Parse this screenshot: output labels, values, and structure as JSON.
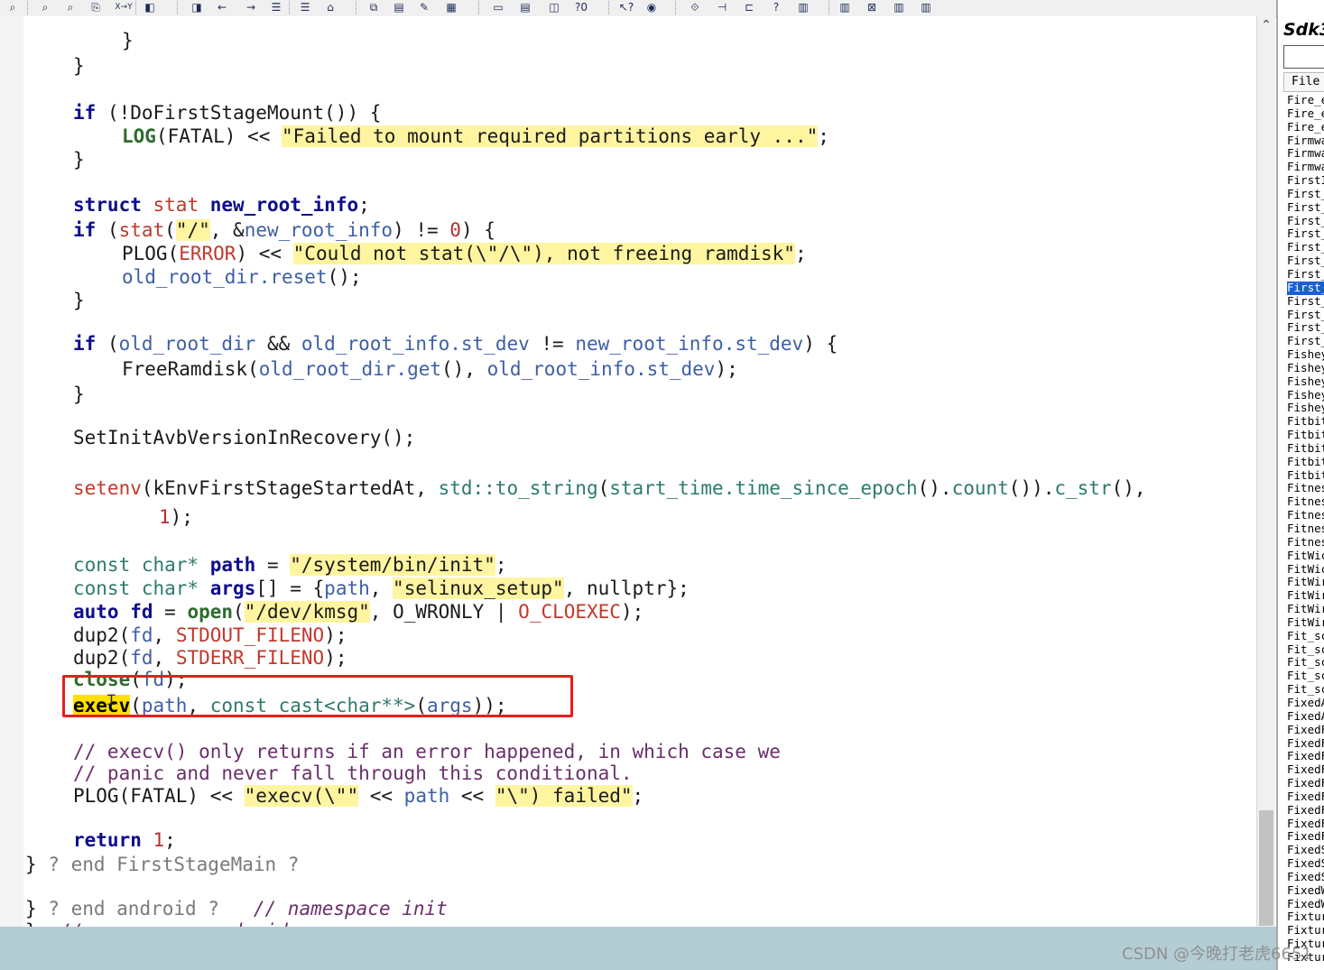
{
  "toolbar": {
    "buttons": [
      {
        "label": "⌕",
        "name": "find-icon"
      },
      {
        "label": "⌕",
        "name": "find-previous-icon"
      },
      {
        "label": "⌕",
        "name": "find-next-icon"
      },
      {
        "label": "⎘",
        "name": "find-in-files-icon"
      },
      {
        "label": "X→Y",
        "name": "replace-icon"
      },
      {
        "label": "◧",
        "name": "bookmark-icon"
      },
      {
        "label": "◨",
        "name": "bookmark-next-icon"
      },
      {
        "label": "←",
        "name": "back-arrow-icon"
      },
      {
        "label": "→",
        "name": "forward-arrow-icon"
      },
      {
        "label": "☰",
        "name": "indent-icon"
      },
      {
        "label": "☰",
        "name": "outdent-icon"
      },
      {
        "label": "⌂",
        "name": "lookup-icon"
      },
      {
        "label": "⧉",
        "name": "jump-icon"
      },
      {
        "label": "▤",
        "name": "book-icon"
      },
      {
        "label": "✎",
        "name": "edit-icon"
      },
      {
        "label": "▦",
        "name": "grid-icon"
      },
      {
        "label": "▭",
        "name": "window-icon"
      },
      {
        "label": "▤",
        "name": "tile-icon"
      },
      {
        "label": "◫",
        "name": "cascade-icon"
      },
      {
        "label": "?0",
        "name": "query-icon"
      },
      {
        "label": "↖?",
        "name": "context-help-icon"
      },
      {
        "label": "◉",
        "name": "browse-icon"
      },
      {
        "label": "⟐",
        "name": "symbol-icon"
      },
      {
        "label": "⊣",
        "name": "relation-icon"
      },
      {
        "label": "⊏",
        "name": "structure-icon"
      },
      {
        "label": "?",
        "name": "help-icon"
      },
      {
        "label": "▥",
        "name": "project-icon"
      },
      {
        "label": "▥",
        "name": "project-open-icon"
      },
      {
        "label": "⊠",
        "name": "project-close-icon"
      },
      {
        "label": "▥",
        "name": "project-add-icon"
      },
      {
        "label": "▥",
        "name": "project-sync-icon"
      }
    ]
  },
  "editor": {
    "lines": [
      {
        "t": 14,
        "l": 109,
        "segs": [
          {
            "c": "p",
            "t": "}"
          }
        ]
      },
      {
        "t": 42,
        "l": 55,
        "segs": [
          {
            "c": "p",
            "t": "}"
          }
        ]
      },
      {
        "t": 94,
        "l": 55,
        "segs": [
          {
            "c": "kw",
            "t": "if"
          },
          {
            "c": "p",
            "t": " (!DoFirstStageMount()) {"
          }
        ]
      },
      {
        "t": 120,
        "l": 109,
        "segs": [
          {
            "c": "fn2",
            "t": "LOG"
          },
          {
            "c": "p",
            "t": "(FATAL) << "
          },
          {
            "c": "str",
            "t": "\"Failed to mount required partitions early ...\""
          },
          {
            "c": "p",
            "t": ";"
          }
        ]
      },
      {
        "t": 146,
        "l": 55,
        "segs": [
          {
            "c": "p",
            "t": "}"
          }
        ]
      },
      {
        "t": 196,
        "l": 55,
        "segs": [
          {
            "c": "kw",
            "t": "struct"
          },
          {
            "c": "p",
            "t": " "
          },
          {
            "c": "mac",
            "t": "stat"
          },
          {
            "c": "p",
            "t": " "
          },
          {
            "c": "kw",
            "t": "new_root_info"
          },
          {
            "c": "p",
            "t": ";"
          }
        ]
      },
      {
        "t": 224,
        "l": 55,
        "segs": [
          {
            "c": "kw",
            "t": "if"
          },
          {
            "c": "p",
            "t": " ("
          },
          {
            "c": "mac",
            "t": "stat"
          },
          {
            "c": "p",
            "t": "("
          },
          {
            "c": "str",
            "t": "\"/\""
          },
          {
            "c": "p",
            "t": ", &"
          },
          {
            "c": "id",
            "t": "new_root_info"
          },
          {
            "c": "p",
            "t": ") != "
          },
          {
            "c": "nm",
            "t": "0"
          },
          {
            "c": "p",
            "t": ") {"
          }
        ]
      },
      {
        "t": 250,
        "l": 109,
        "segs": [
          {
            "c": "p",
            "t": "PLOG("
          },
          {
            "c": "mac",
            "t": "ERROR"
          },
          {
            "c": "p",
            "t": ") << "
          },
          {
            "c": "str",
            "t": "\"Could not stat(\\\"/\\\"), not freeing ramdisk\""
          },
          {
            "c": "p",
            "t": ";"
          }
        ]
      },
      {
        "t": 276,
        "l": 109,
        "segs": [
          {
            "c": "id",
            "t": "old_root_dir.reset"
          },
          {
            "c": "p",
            "t": "();"
          }
        ]
      },
      {
        "t": 302,
        "l": 55,
        "segs": [
          {
            "c": "p",
            "t": "}"
          }
        ]
      },
      {
        "t": 350,
        "l": 55,
        "segs": [
          {
            "c": "kw",
            "t": "if"
          },
          {
            "c": "p",
            "t": " ("
          },
          {
            "c": "id",
            "t": "old_root_dir"
          },
          {
            "c": "p",
            "t": " && "
          },
          {
            "c": "id",
            "t": "old_root_info.st_dev"
          },
          {
            "c": "p",
            "t": " != "
          },
          {
            "c": "id",
            "t": "new_root_info.st_dev"
          },
          {
            "c": "p",
            "t": ") {"
          }
        ]
      },
      {
        "t": 378,
        "l": 109,
        "segs": [
          {
            "c": "p",
            "t": "FreeRamdisk("
          },
          {
            "c": "id",
            "t": "old_root_dir.get"
          },
          {
            "c": "p",
            "t": "(), "
          },
          {
            "c": "id",
            "t": "old_root_info.st_dev"
          },
          {
            "c": "p",
            "t": ");"
          }
        ]
      },
      {
        "t": 406,
        "l": 55,
        "segs": [
          {
            "c": "p",
            "t": "}"
          }
        ]
      },
      {
        "t": 454,
        "l": 55,
        "segs": [
          {
            "c": "p",
            "t": "SetInitAvbVersionInRecovery();"
          }
        ]
      },
      {
        "t": 510,
        "l": 55,
        "segs": [
          {
            "c": "mac",
            "t": "setenv"
          },
          {
            "c": "p",
            "t": "(kEnvFirstStageStartedAt, "
          },
          {
            "c": "ty",
            "t": "std::to_string"
          },
          {
            "c": "p",
            "t": "("
          },
          {
            "c": "ty",
            "t": "start_time.time_since_epoch"
          },
          {
            "c": "p",
            "t": "()."
          },
          {
            "c": "ty",
            "t": "count"
          },
          {
            "c": "p",
            "t": "())."
          },
          {
            "c": "ty",
            "t": "c_str"
          },
          {
            "c": "p",
            "t": "(),"
          }
        ]
      },
      {
        "t": 542,
        "l": 150,
        "segs": [
          {
            "c": "nm",
            "t": "1"
          },
          {
            "c": "p",
            "t": ");"
          }
        ]
      },
      {
        "t": 595,
        "l": 55,
        "segs": [
          {
            "c": "ty",
            "t": "const char*"
          },
          {
            "c": "p",
            "t": " "
          },
          {
            "c": "kw",
            "t": "path"
          },
          {
            "c": "p",
            "t": " = "
          },
          {
            "c": "str",
            "t": "\"/system/bin/init\""
          },
          {
            "c": "p",
            "t": ";"
          }
        ]
      },
      {
        "t": 621,
        "l": 55,
        "segs": [
          {
            "c": "ty",
            "t": "const char*"
          },
          {
            "c": "p",
            "t": " "
          },
          {
            "c": "kw",
            "t": "args"
          },
          {
            "c": "p",
            "t": "[] = {"
          },
          {
            "c": "id",
            "t": "path"
          },
          {
            "c": "p",
            "t": ", "
          },
          {
            "c": "str",
            "t": "\"selinux_setup\""
          },
          {
            "c": "p",
            "t": ", nullptr};"
          }
        ]
      },
      {
        "t": 647,
        "l": 55,
        "segs": [
          {
            "c": "kw",
            "t": "auto"
          },
          {
            "c": "p",
            "t": " "
          },
          {
            "c": "kw",
            "t": "fd"
          },
          {
            "c": "p",
            "t": " = "
          },
          {
            "c": "fn2",
            "t": "open"
          },
          {
            "c": "p",
            "t": "("
          },
          {
            "c": "str",
            "t": "\"/dev/kmsg\""
          },
          {
            "c": "p",
            "t": ", O_WRONLY | "
          },
          {
            "c": "mac",
            "t": "O_CLOEXEC"
          },
          {
            "c": "p",
            "t": ");"
          }
        ]
      },
      {
        "t": 673,
        "l": 55,
        "segs": [
          {
            "c": "p",
            "t": "dup2("
          },
          {
            "c": "id",
            "t": "fd"
          },
          {
            "c": "p",
            "t": ", "
          },
          {
            "c": "mac",
            "t": "STDOUT_FILENO"
          },
          {
            "c": "p",
            "t": ");"
          }
        ]
      },
      {
        "t": 698,
        "l": 55,
        "segs": [
          {
            "c": "p",
            "t": "dup2("
          },
          {
            "c": "id",
            "t": "fd"
          },
          {
            "c": "p",
            "t": ", "
          },
          {
            "c": "mac",
            "t": "STDERR_FILENO"
          },
          {
            "c": "p",
            "t": ");"
          }
        ]
      },
      {
        "t": 722,
        "l": 55,
        "segs": [
          {
            "c": "fn2",
            "t": "close"
          },
          {
            "c": "p",
            "t": "("
          },
          {
            "c": "id",
            "t": "fd"
          },
          {
            "c": "p",
            "t": ");"
          }
        ]
      },
      {
        "t": 751,
        "l": 55,
        "segs": [
          {
            "c": "hl",
            "t": "execv"
          },
          {
            "c": "p",
            "t": "("
          },
          {
            "c": "id",
            "t": "path"
          },
          {
            "c": "p",
            "t": ", "
          },
          {
            "c": "ty",
            "t": "const_cast<char**>"
          },
          {
            "c": "p",
            "t": "("
          },
          {
            "c": "id",
            "t": "args"
          },
          {
            "c": "p",
            "t": "));"
          }
        ]
      },
      {
        "t": 802,
        "l": 55,
        "segs": [
          {
            "c": "cm",
            "t": "// execv() only returns if an error happened, in which case we"
          }
        ]
      },
      {
        "t": 826,
        "l": 55,
        "segs": [
          {
            "c": "cm",
            "t": "// panic and never fall through this conditional."
          }
        ]
      },
      {
        "t": 851,
        "l": 55,
        "segs": [
          {
            "c": "p",
            "t": "PLOG(FATAL) << "
          },
          {
            "c": "str",
            "t": "\"execv(\\\"\""
          },
          {
            "c": "p",
            "t": " << "
          },
          {
            "c": "id",
            "t": "path"
          },
          {
            "c": "p",
            "t": " << "
          },
          {
            "c": "str",
            "t": "\"\\\") failed\""
          },
          {
            "c": "p",
            "t": ";"
          }
        ]
      },
      {
        "t": 900,
        "l": 55,
        "segs": [
          {
            "c": "kw",
            "t": "return"
          },
          {
            "c": "p",
            "t": " "
          },
          {
            "c": "nm",
            "t": "1"
          },
          {
            "c": "p",
            "t": ";"
          }
        ]
      },
      {
        "t": 927,
        "l": 2,
        "segs": [
          {
            "c": "p",
            "t": "}"
          },
          {
            "c": "gr",
            "t": " ? end FirstStageMain ?"
          }
        ]
      },
      {
        "t": 976,
        "l": 2,
        "segs": [
          {
            "c": "p",
            "t": "}"
          },
          {
            "c": "gr",
            "t": " ? end android ?   "
          },
          {
            "c": "cm ital",
            "t": "// namespace init"
          }
        ]
      },
      {
        "t": 1001,
        "l": 2,
        "segs": [
          {
            "c": "p",
            "t": "}"
          },
          {
            "c": "cm ital",
            "t": "  // namespace android"
          }
        ]
      }
    ]
  },
  "symbol_panel": {
    "title": "Sdk3",
    "search_value": "",
    "column_header": "File",
    "selected_index": 14,
    "items": [
      "Fire_e",
      "Fire_e",
      "Fire_e",
      "Firmwa",
      "Firmwa",
      "Firmwa",
      "FirstI",
      "First_",
      "First_",
      "First_",
      "First_",
      "First_",
      "First_",
      "First_",
      "First_",
      "First_",
      "First_",
      "First_",
      "First_",
      "Fishey",
      "Fishey",
      "Fishey",
      "Fishey",
      "Fishey",
      "Fitbit",
      "Fitbit",
      "Fitbit",
      "Fitbit",
      "Fitbit",
      "Fitnes",
      "Fitnes",
      "Fitnes",
      "Fitnes",
      "Fitnes",
      "FitWic",
      "FitWic",
      "FitWir",
      "FitWir",
      "FitWir",
      "FitWir",
      "Fit_sc",
      "Fit_sc",
      "Fit_sc",
      "Fit_sc",
      "Fit_sc",
      "FixedA",
      "FixedA",
      "FixedF",
      "FixedF",
      "FixedF",
      "FixedF",
      "FixedF",
      "FixedF",
      "FixedF",
      "FixedF",
      "FixedF",
      "FixedS",
      "FixedS",
      "FixedS",
      "FixedW",
      "FixedW",
      "Fixtur",
      "Fixtur",
      "Fixtur",
      "Fixtur"
    ]
  },
  "watermark": "CSDN @今晚打老虎6651"
}
